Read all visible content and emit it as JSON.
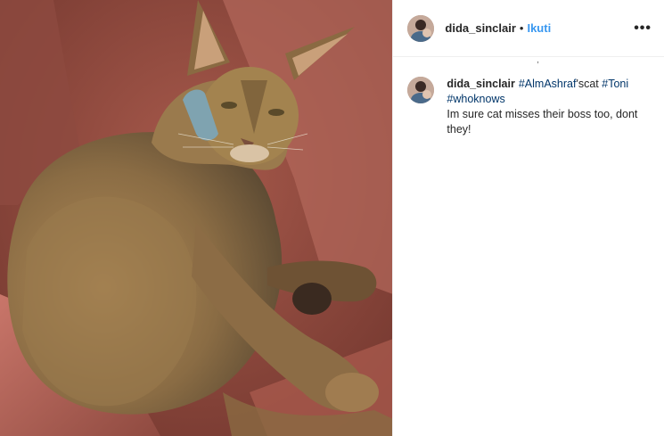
{
  "post": {
    "username": "dida_sinclair",
    "separator": "•",
    "follow_label": "Ikuti",
    "more_icon": "more-dots-icon",
    "image_icon": "cat-photo",
    "stray_mark": ",",
    "caption": {
      "username": "dida_sinclair",
      "mention": "#AlmAshraf",
      "mention_suffix": "'scat",
      "hashtag1": "#Toni",
      "hashtag2": "#whoknows",
      "text": "Im sure cat misses their boss too, dont they!"
    },
    "colors": {
      "link": "#3897f0",
      "hashtag": "#003569",
      "text": "#262626",
      "divider": "#efefef"
    }
  }
}
